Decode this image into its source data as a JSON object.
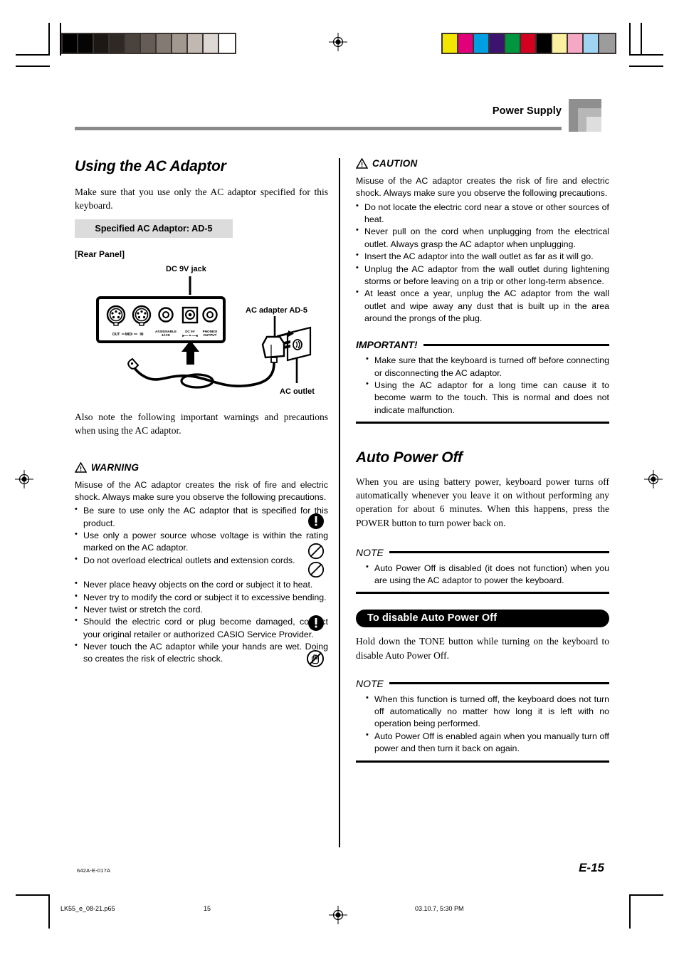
{
  "header": {
    "title": "Power Supply"
  },
  "left_column": {
    "section_title": "Using the AC Adaptor",
    "intro": "Make sure that you use only the AC adaptor specified for this keyboard.",
    "spec_box": "Specified AC Adaptor: AD-5",
    "rear_panel_label": "[Rear Panel]",
    "diagram": {
      "dc_jack_label": "DC 9V jack",
      "ac_adapter_label": "AC adapter AD-5",
      "ac_outlet_label": "AC outlet",
      "port_labels": {
        "midi_out": "OUT",
        "midi": "MIDI",
        "midi_in": "IN",
        "assignable": "ASSIGNABLE\nJACK",
        "dc9v": "DC 9V",
        "phones": "PHONES/\nOUTPUT"
      }
    },
    "also_note": "Also note the following important warnings and precautions when using the AC adaptor.",
    "warning": {
      "label": "WARNING",
      "body": "Misuse of the AC adaptor creates the risk of fire and electric shock. Always make sure you observe the following precautions.",
      "items": [
        "Be sure to use only the AC adaptor that is specified for this product.",
        "Use only a power source whose voltage is within the rating marked on the AC adaptor.",
        "Do not overload electrical outlets and extension cords.",
        "Never place heavy objects on the cord or subject it to heat.",
        "Never try to modify the cord or subject it to excessive bending.",
        "Never twist or stretch the cord.",
        "Should the electric cord or plug become damaged, contact your original retailer or authorized CASIO Service Provider.",
        "Never touch the AC adaptor while your hands are wet. Doing so creates the risk of electric shock."
      ]
    }
  },
  "right_column": {
    "caution": {
      "label": "CAUTION",
      "body": "Misuse of the AC adaptor creates the risk of fire and electric shock. Always make sure you observe the following precautions.",
      "items": [
        "Do not locate the electric cord near a stove or other sources of heat.",
        "Never pull on the cord when unplugging from the electrical outlet.  Always grasp the AC adaptor when unplugging.",
        "Insert the AC adaptor into the wall outlet as far as it will go.",
        "Unplug the AC adaptor from the wall outlet during lightening storms or before leaving on a trip or other long-term absence.",
        "At least once a year, unplug the AC adaptor from the wall outlet and wipe away any dust that is built up in the area around the prongs of the plug."
      ]
    },
    "important": {
      "label": "IMPORTANT!",
      "items": [
        "Make sure that the keyboard is turned off before connecting or disconnecting the AC adaptor.",
        "Using the AC adaptor for a long time can cause it to become warm to the touch. This is normal and does not indicate malfunction."
      ]
    },
    "auto_power_off": {
      "section_title": "Auto Power Off",
      "body": "When you are using battery power, keyboard power turns off automatically whenever you leave it on without performing any operation for about 6 minutes. When this happens, press the POWER button to turn power back on.",
      "note_label": "NOTE",
      "note_items": [
        "Auto Power Off is disabled (it does not function) when you are using the AC adaptor to power the keyboard."
      ]
    },
    "disable": {
      "pill_title": "To disable Auto Power Off",
      "body": "Hold down the TONE button while turning on the keyboard to disable Auto Power Off.",
      "note_label": "NOTE",
      "note_items": [
        "When this function is turned off, the keyboard does not turn off automatically no matter how long it is left with no operation being performed.",
        "Auto Power Off is enabled again when you manually turn off power and then turn it back on again."
      ]
    }
  },
  "footer": {
    "doc_code": "642A-E-017A",
    "page_number": "E-15",
    "pdf_file": "LK55_e_08-21.p65",
    "pdf_page": "15",
    "pdf_date": "03.10.7, 5:30 PM"
  },
  "print_marks": {
    "gray_bar_colors": [
      "#000000",
      "#050505",
      "#1c1816",
      "#2f2926",
      "#4a423d",
      "#655c56",
      "#837a74",
      "#a19890",
      "#c0b8b1",
      "#ddd8d3",
      "#ffffff"
    ],
    "color_bar_colors": [
      "#f2e500",
      "#e2007a",
      "#009fe3",
      "#3c1470",
      "#009640",
      "#d30020",
      "#000000",
      "#faf0a0",
      "#f5a8c4",
      "#9fd5f2",
      "#9c9c9c"
    ]
  }
}
